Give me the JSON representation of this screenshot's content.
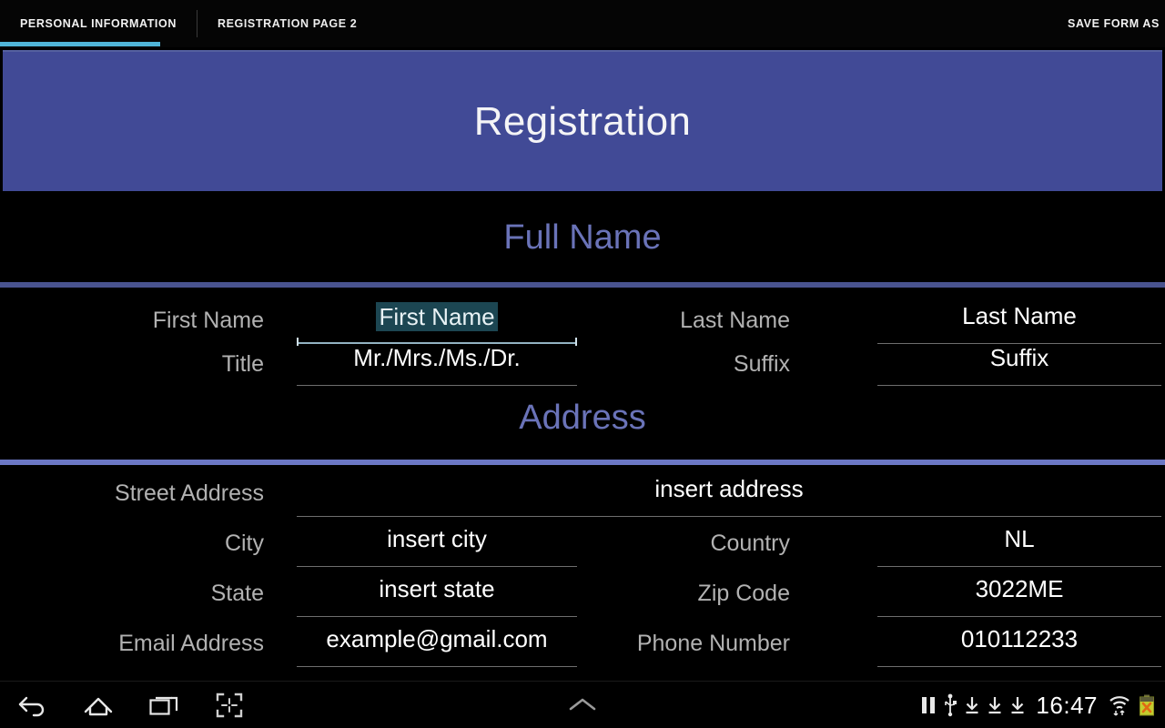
{
  "actionbar": {
    "tabs": [
      {
        "label": "PERSONAL INFORMATION",
        "active": true
      },
      {
        "label": "REGISTRATION PAGE 2",
        "active": false
      }
    ],
    "save_label": "SAVE FORM AS",
    "accent_color": "#4fb4d8"
  },
  "banner": {
    "title": "Registration",
    "background_color": "#414a96",
    "text_color": "#f4f4f6"
  },
  "sections": [
    {
      "heading": "Full Name",
      "divider_color": "#49538f"
    },
    {
      "heading": "Address",
      "divider_color": "#6b77c4"
    }
  ],
  "section_heading_color": "#6a73b8",
  "fullname": {
    "rows": [
      {
        "left_label": "First Name",
        "left_value": "First Name",
        "left_focused": true,
        "right_label": "Last Name",
        "right_value": "Last Name",
        "right_focused": false
      },
      {
        "left_label": "Title",
        "left_value": "Mr./Mrs./Ms./Dr.",
        "left_focused": false,
        "right_label": "Suffix",
        "right_value": "Suffix",
        "right_focused": false
      }
    ]
  },
  "address": {
    "street": {
      "label": "Street Address",
      "value": "insert address"
    },
    "rows": [
      {
        "left_label": "City",
        "left_value": "insert city",
        "right_label": "Country",
        "right_value": "NL"
      },
      {
        "left_label": "State",
        "left_value": "insert state",
        "right_label": "Zip Code",
        "right_value": "3022ME"
      },
      {
        "left_label": "Email Address",
        "left_value": "example@gmail.com",
        "right_label": "Phone Number",
        "right_value": "010112233"
      }
    ]
  },
  "navbar": {
    "back_icon": "back-arrow-icon",
    "home_icon": "home-icon",
    "recents_icon": "recent-apps-icon",
    "screenshot_icon": "screenshot-icon",
    "ime_icon": "chevron-up-icon",
    "tray": {
      "pause_icon": "pause-icon",
      "usb_icon": "usb-icon",
      "download_icons": [
        "download-icon",
        "download-icon",
        "download-icon"
      ],
      "clock": "16:47",
      "wifi_icon": "wifi-icon",
      "battery_icon": "battery-error-icon"
    }
  },
  "selection_color": "#1c4652",
  "field_underline_color": "#6e6e6e"
}
